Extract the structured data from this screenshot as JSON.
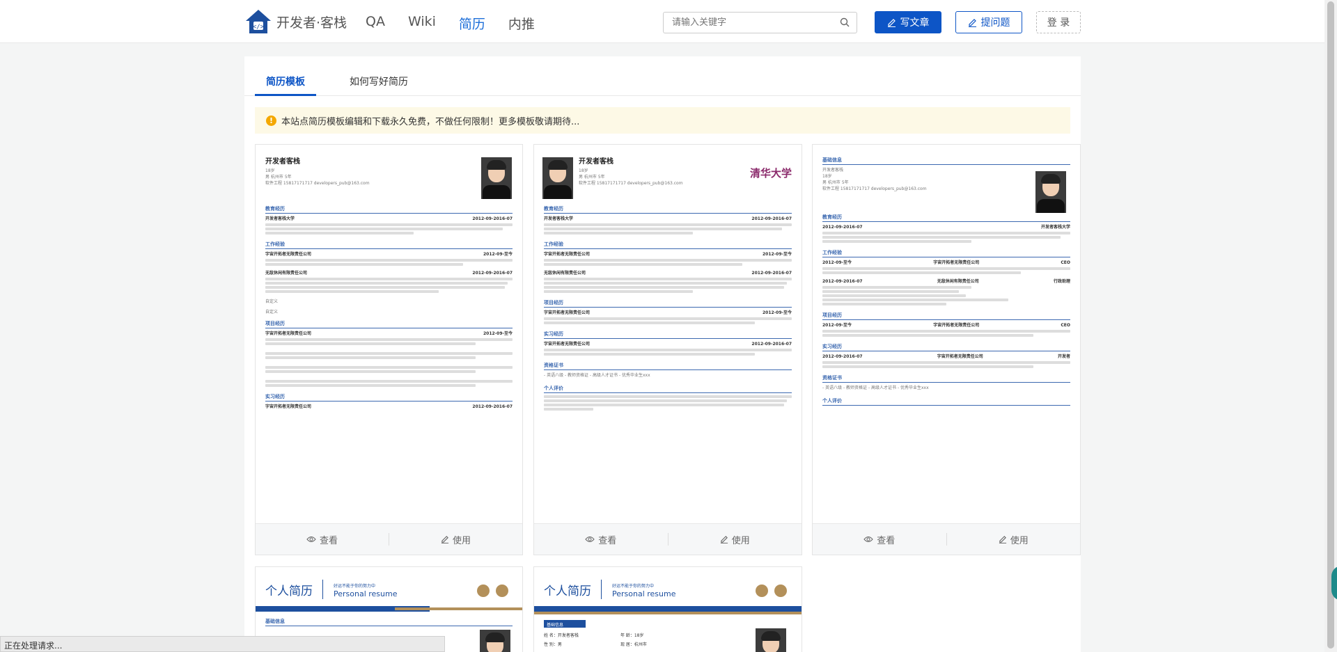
{
  "header": {
    "logo_text": "开发者·客栈",
    "nav": [
      "QA",
      "Wiki",
      "简历",
      "内推"
    ],
    "active_nav": "简历",
    "search_placeholder": "请输入关键字",
    "write_article": "写文章",
    "ask_question": "提问题",
    "login": "登 录"
  },
  "tabs": [
    "简历模板",
    "如何写好简历"
  ],
  "notice": "本站点简历模板编辑和下载永久免费，不做任何限制！更多模板敬请期待...",
  "card_actions": {
    "view": "查看",
    "use": "使用"
  },
  "resume": {
    "name": "开发者客栈",
    "age": "18岁",
    "city_exp": "男 杭州市 5年",
    "contact": "软件工程 15817171717 developers_pub@163.com",
    "sections": {
      "education": "教育经历",
      "work": "工作经验",
      "project": "项目经历",
      "internship": "实习经历",
      "certificate": "资格证书",
      "evaluation": "个人评价",
      "basic": "基础信息"
    },
    "school": "开发者客栈大学",
    "date1": "2012-09-2016-07",
    "company1": "字宙开拓者无限责任公司",
    "date2": "2012-09-至今",
    "company2": "无敌休闲有限责任公司",
    "custom": "自定义",
    "certs": "- 英语八级 - 教师资格证 - 高级人才证书 - 优秀毕业生xxx",
    "univ_logo": "清华大学",
    "role_ceo": "CEO",
    "role_admin": "行政助理",
    "role_intern": "开发者"
  },
  "personal_resume": {
    "title": "个人简历",
    "tagline": "好运不能于你的努力中",
    "subtitle": "Personal resume",
    "basic": "基础信息",
    "name_label": "姓 名：",
    "name_value": "开发者客栈",
    "age_label": "年 龄：",
    "age_value": "18岁",
    "gender_label": "性 别：",
    "gender_value": "男",
    "city_label": "现 居：",
    "city_value": "杭州市"
  },
  "status_bar": "正在处理请求..."
}
